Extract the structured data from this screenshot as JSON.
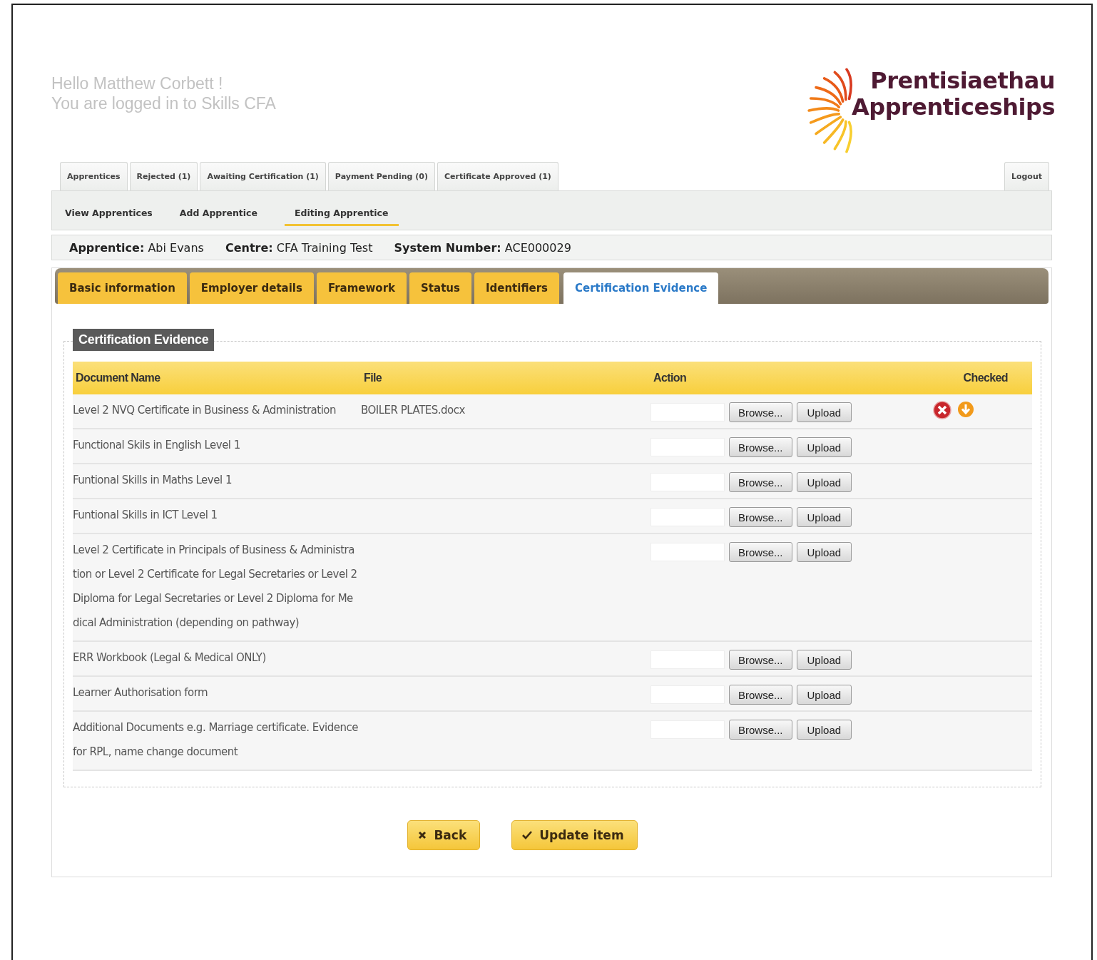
{
  "greeting": [
    "Hello Matthew Corbett !",
    "You are logged in to Skills CFA"
  ],
  "logo": {
    "line_1": "Prentisiaethau",
    "line_2": "Apprenticeships"
  },
  "top_tabs": [
    {
      "label": "Apprentices",
      "selected": false
    },
    {
      "label": "Rejected (1)",
      "selected": false
    },
    {
      "label": "Awaiting Certification (1)",
      "selected": false
    },
    {
      "label": "Payment Pending (0)",
      "selected": false
    },
    {
      "label": "Certificate Approved (1)",
      "selected": false
    }
  ],
  "logout": "Logout",
  "sub_nav": [
    {
      "label": "View Apprentices",
      "selected": false
    },
    {
      "label": "Add Apprentice",
      "selected": false
    },
    {
      "label": "Editing Apprentice",
      "selected": true
    }
  ],
  "info_bar": [
    {
      "label": "Apprentice:",
      "value": "Abi Evans"
    },
    {
      "label": "Centre:",
      "value": "CFA Training Test"
    },
    {
      "label": "System Number:",
      "value": "ACE000029"
    }
  ],
  "section_tabs": [
    {
      "label": "Basic information",
      "selected": false
    },
    {
      "label": "Employer details",
      "selected": false
    },
    {
      "label": "Framework",
      "selected": false
    },
    {
      "label": "Status",
      "selected": false
    },
    {
      "label": "Identifiers",
      "selected": false
    },
    {
      "label": "Certification Evidence",
      "selected": true
    }
  ],
  "fieldset_title": "Certification Evidence",
  "table": {
    "columns": [
      "Document Name",
      "File",
      "Action",
      "Checked"
    ],
    "rows": [
      {
        "document_name": [
          "Level 2 NVQ Certificate in Business & Administration"
        ],
        "file": "BOILER PLATES.docx",
        "browse": "Browse...",
        "upload": "Upload"
      },
      {
        "document_name": [
          "Functional Skils in English Level 1"
        ],
        "browse": "Browse...",
        "upload": "Upload"
      },
      {
        "document_name": [
          "Funtional Skills in Maths Level 1"
        ],
        "browse": "Browse...",
        "upload": "Upload"
      },
      {
        "document_name": [
          "Funtional Skills in ICT Level 1"
        ],
        "browse": "Browse...",
        "upload": "Upload"
      },
      {
        "document_name": [
          "Level 2 Certificate in Principals of Business & Administra",
          "tion or Level 2 Certificate for Legal Secretaries or Level 2",
          "Diploma for Legal Secretaries or Level 2 Diploma for Me",
          "dical Administration (depending on pathway)"
        ],
        "browse": "Browse...",
        "upload": "Upload"
      },
      {
        "document_name": [
          "ERR Workbook (Legal & Medical ONLY)"
        ],
        "browse": "Browse...",
        "upload": "Upload"
      },
      {
        "document_name": [
          "Learner Authorisation form"
        ],
        "browse": "Browse...",
        "upload": "Upload"
      },
      {
        "document_name": [
          "Additional Documents e.g. Marriage certificate. Evidence",
          "for RPL, name change document"
        ],
        "browse": "Browse...",
        "upload": "Upload"
      }
    ]
  },
  "buttons": [
    {
      "kind": "back",
      "label": "Back"
    },
    {
      "kind": "update",
      "label": "Update item"
    }
  ]
}
